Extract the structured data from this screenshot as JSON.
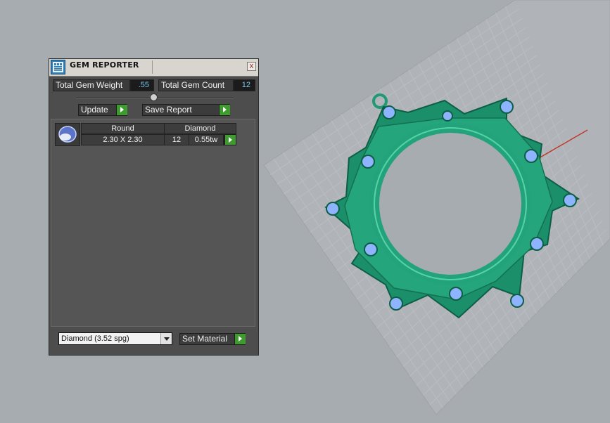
{
  "panel": {
    "title": "GEM REPORTER",
    "close_label": "x",
    "total_gem_weight_label": "Total Gem Weight",
    "total_gem_weight_value": ".55",
    "total_gem_count_label": "Total Gem Count",
    "total_gem_count_value": "12",
    "update_label": "Update",
    "save_report_label": "Save Report",
    "gem_row": {
      "shape": "Round",
      "material": "Diamond",
      "size": "2.30 X 2.30",
      "count": "12",
      "weight": "0.55tw"
    },
    "material_select_value": "Diamond    (3.52 spg)",
    "set_material_label": "Set Material"
  },
  "colors": {
    "viewport_bg": "#a7acb1",
    "grid_line": "#b9bdc1",
    "model_green": "#1f9a73",
    "gem_blue": "#8fb4ff",
    "axis_red": "#c0392b",
    "axis_green": "#3a9a3a",
    "button_arrow_green": "#3f9b2f",
    "value_text": "#7ec8f0"
  }
}
